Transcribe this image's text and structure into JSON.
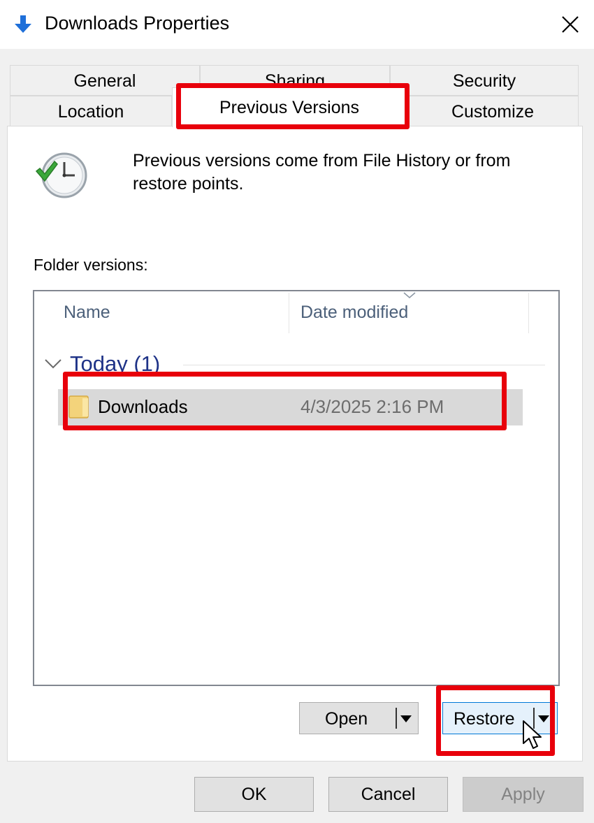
{
  "window": {
    "title": "Downloads Properties",
    "close_glyph": "✕"
  },
  "tabs": {
    "general": "General",
    "sharing": "Sharing",
    "security": "Security",
    "location": "Location",
    "previous_versions": "Previous Versions",
    "customize": "Customize",
    "active": "Previous Versions"
  },
  "info": {
    "text": "Previous versions come from File History or from restore points.",
    "icon": "clock-restore-icon"
  },
  "list": {
    "label": "Folder versions:",
    "columns": [
      "Name",
      "Date modified"
    ],
    "group": {
      "title": "Today (1)",
      "items": [
        {
          "name": "Downloads",
          "date_modified": "4/3/2025 2:16 PM",
          "icon": "folder-icon"
        }
      ]
    }
  },
  "actions": {
    "open": "Open",
    "restore": "Restore"
  },
  "footer": {
    "ok": "OK",
    "cancel": "Cancel",
    "apply": "Apply"
  },
  "colors": {
    "highlight": "#e8000b",
    "group_title": "#1e3287",
    "title_icon": "#1e6fd9"
  }
}
